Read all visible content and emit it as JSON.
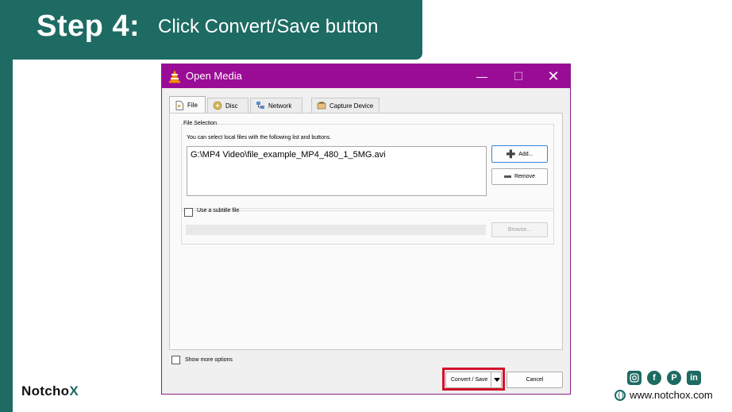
{
  "banner": {
    "step": "Step 4:",
    "description": "Click Convert/Save button"
  },
  "window": {
    "title": "Open Media",
    "controls": {
      "minimize": "—",
      "maximize": "☐",
      "close": "✕"
    }
  },
  "tabs": [
    {
      "label": "File",
      "icon": "file-icon",
      "active": true
    },
    {
      "label": "Disc",
      "icon": "disc-icon",
      "active": false
    },
    {
      "label": "Network",
      "icon": "network-icon",
      "active": false
    },
    {
      "label": "Capture Device",
      "icon": "capture-device-icon",
      "active": false
    }
  ],
  "file_selection": {
    "group_label": "File Selection",
    "hint": "You can select local files with the following list and buttons.",
    "files": [
      "G:\\MP4 Video\\file_example_MP4_480_1_5MG.avi"
    ],
    "add_label": "Add...",
    "remove_label": "Remove"
  },
  "subtitle": {
    "checkbox_label": "Use a subtitle file",
    "checked": false,
    "field_value": "",
    "browse_label": "Browse..."
  },
  "options": {
    "show_more_label": "Show more options",
    "checked": false
  },
  "actions": {
    "convert_label": "Convert / Save",
    "cancel_label": "Cancel"
  },
  "footer": {
    "brand_prefix": "Notch",
    "brand_o": "o",
    "brand_x": "X",
    "social": [
      "instagram-icon",
      "facebook-icon",
      "pinterest-icon",
      "linkedin-icon"
    ],
    "website": "www.notchox.com"
  },
  "colors": {
    "banner": "#1d6b63",
    "titlebar": "#9b0c96",
    "highlight": "#d3122b"
  }
}
